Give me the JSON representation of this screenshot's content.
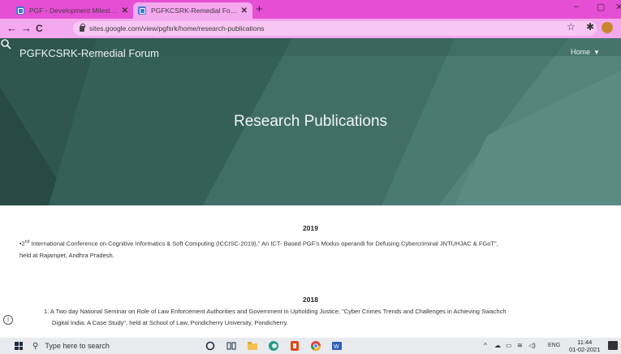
{
  "browser": {
    "tabs": [
      {
        "title": "PGF - Development Milestones",
        "active": false
      },
      {
        "title": "PGFKCSRK-Remedial Forum - Re",
        "active": true
      }
    ],
    "new_tab": "+",
    "window_controls": {
      "minimize": "–",
      "maximize": "▢",
      "close": "✕"
    },
    "url": "sites.google.com/view/pgfsrk/home/research-publications",
    "accent_color": "#e64fd4"
  },
  "site": {
    "title": "PGFKCSRK-Remedial Forum",
    "nav_home": "Home",
    "hero_title": "Research Publications",
    "hero_color": "#3c6860"
  },
  "sections": [
    {
      "year": "2019",
      "line1_prefix": "•2",
      "line1_sup": "nd",
      "line1_text": " International Conference on Cognitive Informatics & Soft Computing (ICCISC-2019),\" An ICT- Based PGF's Modus operandi for Defusing Cybercriminal JNTUHJAC & FGoT\",",
      "line2": "held at Rajampet, Andhra Pradesh."
    },
    {
      "year": "2018",
      "line1": "1. A Two day National Seminar on Role of Law Enforcement Authorities and Government in Upholding Justice, \"Cyber Crimes Trends and Challenges in Achieving Swachch",
      "line2": "Digital India: A Case Study\", held at School of Law, Pondicherry University, Pondicherry."
    }
  ],
  "taskbar": {
    "search_placeholder": "Type here to search",
    "language": "ENG",
    "time": "11:44",
    "date": "01-02-2021"
  }
}
